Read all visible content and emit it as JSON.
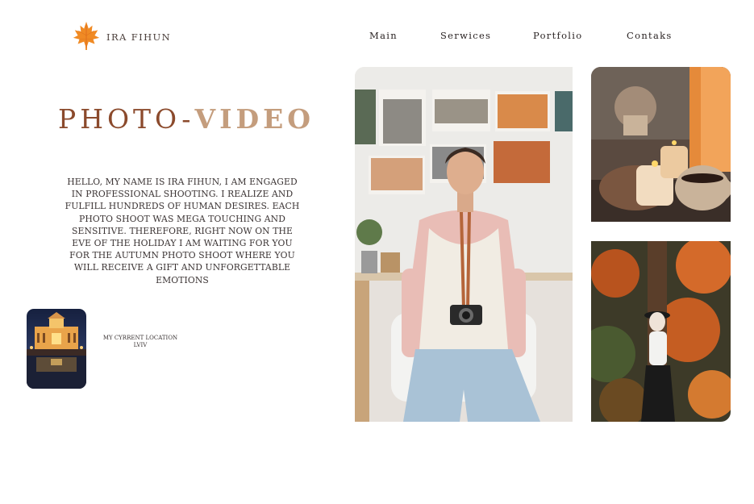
{
  "brand": {
    "name": "IRA FIHUN",
    "icon": "maple-leaf-icon"
  },
  "nav": {
    "items": [
      "Main",
      "Serwices",
      "Portfolio",
      "Contaks"
    ]
  },
  "hero": {
    "title_part1": "PHOTO-",
    "title_part2": "VIDEO"
  },
  "intro": {
    "text": "HELLO, MY NAME IS IRA FIHUN, I AM ENGAGED IN PROFESSIONAL SHOOTING. I REALIZE AND FULFILL HUNDREDS OF HUMAN DESIRES. EACH PHOTO SHOOT WAS MEGA TOUCHING AND SENSITIVE. THEREFORE, RIGHT NOW ON THE EVE OF THE HOLIDAY I AM WAITING FOR YOU FOR THE AUTUMN PHOTO SHOOT WHERE YOU WILL RECEIVE A GIFT AND UNFORGETTABLE EMOTIONS"
  },
  "location": {
    "label": "MY CYRRENT LOCATION",
    "city": "LVIV"
  },
  "colors": {
    "title_dark": "#8b4a2c",
    "title_light": "#c49d7d",
    "logo_orange": "#f08a24",
    "text": "#3b3434"
  }
}
